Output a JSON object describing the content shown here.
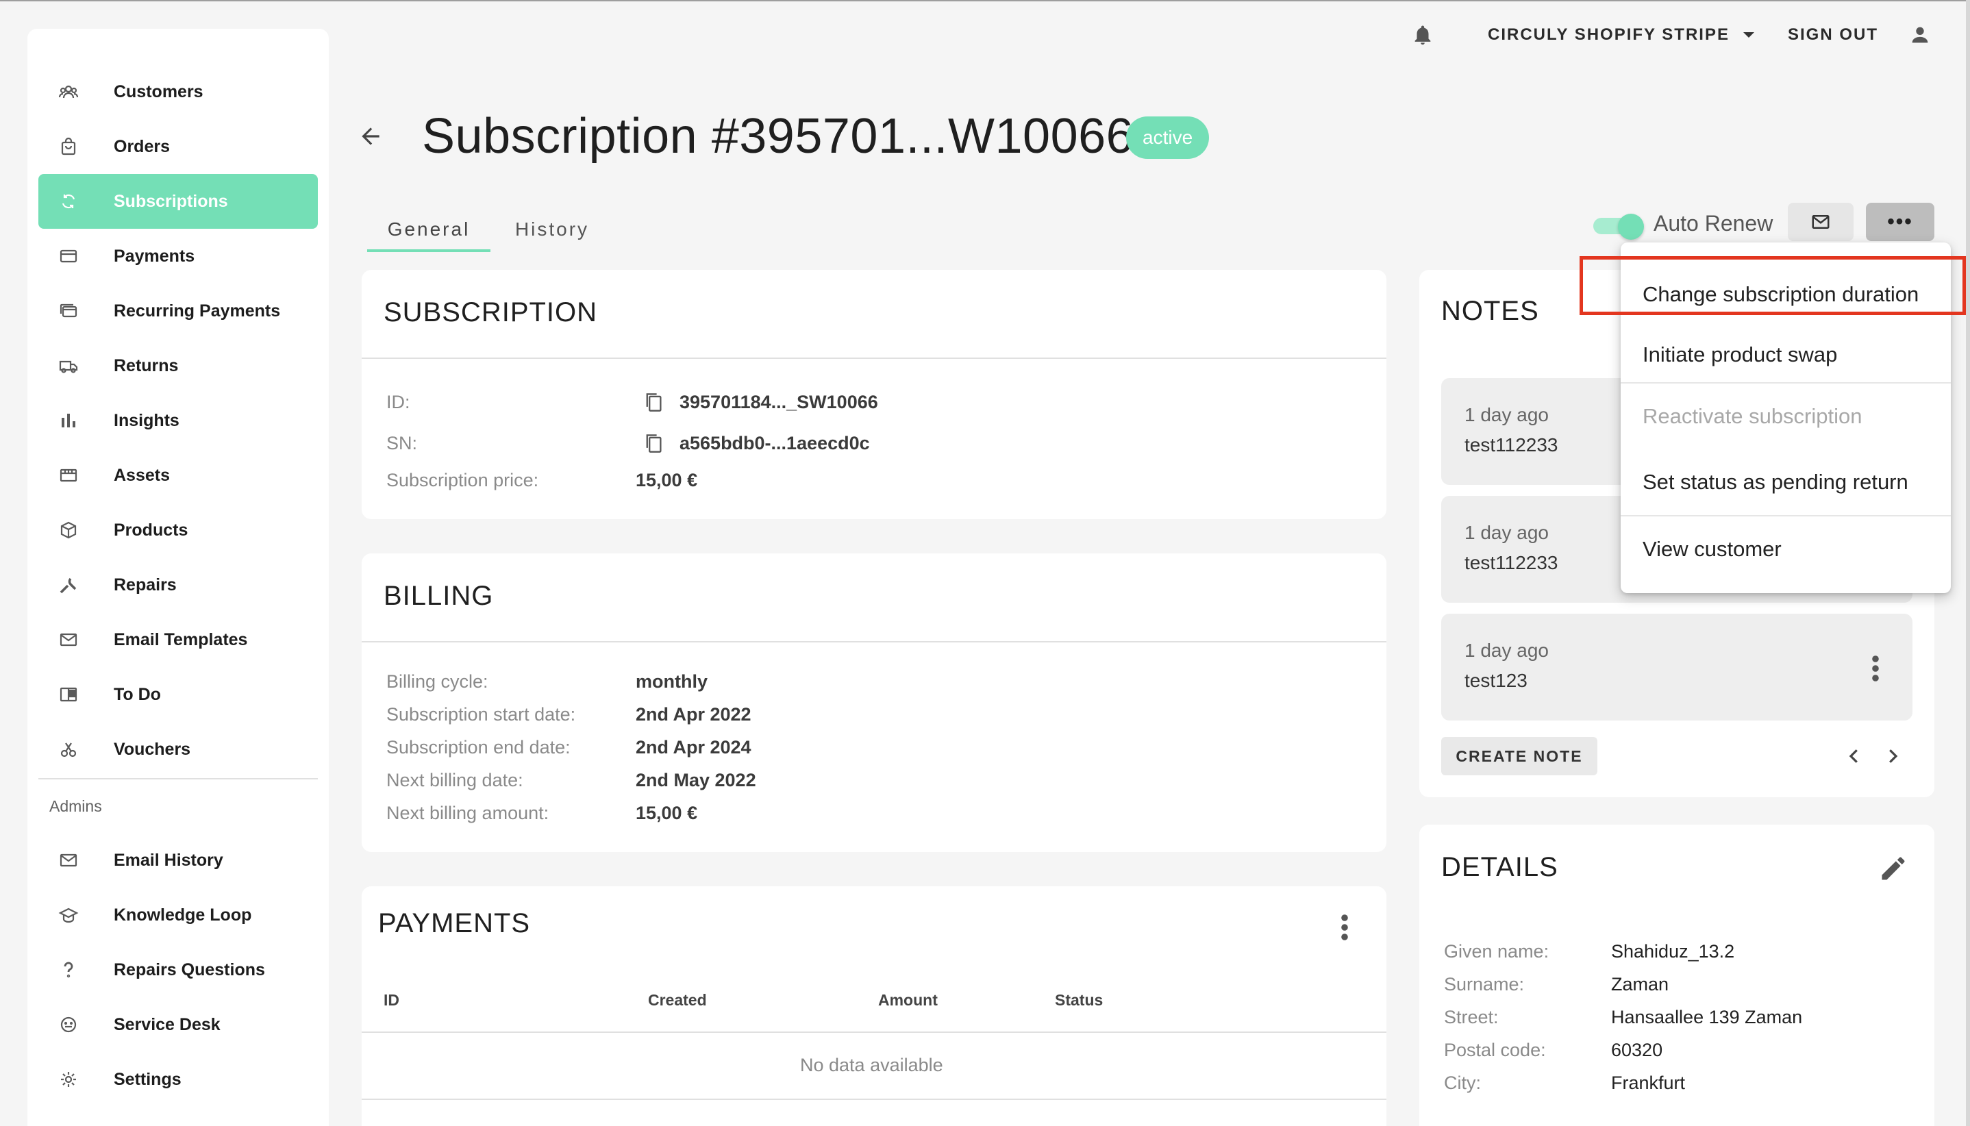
{
  "topbar": {
    "org_label": "CIRCULY SHOPIFY STRIPE",
    "sign_out_label": "SIGN OUT"
  },
  "sidebar": {
    "items": [
      {
        "label": "Customers",
        "icon": "customers-icon"
      },
      {
        "label": "Orders",
        "icon": "orders-icon"
      },
      {
        "label": "Subscriptions",
        "icon": "subscriptions-icon",
        "active": true
      },
      {
        "label": "Payments",
        "icon": "payments-icon"
      },
      {
        "label": "Recurring Payments",
        "icon": "recurring-payments-icon"
      },
      {
        "label": "Returns",
        "icon": "returns-icon"
      },
      {
        "label": "Insights",
        "icon": "insights-icon"
      },
      {
        "label": "Assets",
        "icon": "assets-icon"
      },
      {
        "label": "Products",
        "icon": "products-icon"
      },
      {
        "label": "Repairs",
        "icon": "repairs-icon"
      },
      {
        "label": "Email Templates",
        "icon": "email-templates-icon"
      },
      {
        "label": "To Do",
        "icon": "to-do-icon"
      },
      {
        "label": "Vouchers",
        "icon": "vouchers-icon"
      }
    ],
    "admins_heading": "Admins",
    "admin_items": [
      {
        "label": "Email History",
        "icon": "email-history-icon"
      },
      {
        "label": "Knowledge Loop",
        "icon": "knowledge-loop-icon"
      },
      {
        "label": "Repairs Questions",
        "icon": "repairs-questions-icon"
      },
      {
        "label": "Service Desk",
        "icon": "service-desk-icon"
      },
      {
        "label": "Settings",
        "icon": "settings-icon"
      }
    ]
  },
  "header": {
    "title": "Subscription #395701...W10066",
    "status_badge": "active"
  },
  "tabs": [
    {
      "label": "General",
      "active": true
    },
    {
      "label": "History"
    }
  ],
  "actions": {
    "auto_renew_label": "Auto Renew",
    "auto_renew_on": true,
    "more_label": "•••"
  },
  "subscription": {
    "title": "SUBSCRIPTION",
    "id_label": "ID:",
    "id_value": "395701184..._SW10066",
    "sn_label": "SN:",
    "sn_value": "a565bdb0-...1aeecd0c",
    "price_label": "Subscription price:",
    "price_value": "15,00 €"
  },
  "billing": {
    "title": "BILLING",
    "rows": [
      {
        "label": "Billing cycle:",
        "value": "monthly"
      },
      {
        "label": "Subscription start date:",
        "value": "2nd Apr 2022"
      },
      {
        "label": "Subscription end date:",
        "value": "2nd Apr 2024"
      },
      {
        "label": "Next billing date:",
        "value": "2nd May 2022"
      },
      {
        "label": "Next billing amount:",
        "value": "15,00 €"
      }
    ]
  },
  "payments": {
    "title": "PAYMENTS",
    "columns": [
      "ID",
      "Created",
      "Amount",
      "Status"
    ],
    "empty_text": "No data available"
  },
  "notes": {
    "title": "NOTES",
    "items": [
      {
        "time": "1 day ago",
        "text": "test112233"
      },
      {
        "time": "1 day ago",
        "text": "test112233"
      },
      {
        "time": "1 day ago",
        "text": "test123"
      }
    ],
    "create_label": "CREATE NOTE"
  },
  "details": {
    "title": "DETAILS",
    "rows": [
      {
        "label": "Given name:",
        "value": "Shahiduz_13.2"
      },
      {
        "label": "Surname:",
        "value": "Zaman"
      },
      {
        "label": "Street:",
        "value": "Hansaallee 139 Zaman"
      },
      {
        "label": "Postal code:",
        "value": "60320"
      },
      {
        "label": "City:",
        "value": "Frankfurt"
      }
    ]
  },
  "menu": {
    "items": [
      {
        "label": "Change subscription duration",
        "disabled": false
      },
      {
        "label": "Initiate product swap",
        "disabled": false
      },
      {
        "label": "Reactivate subscription",
        "disabled": true
      },
      {
        "label": "Set status as pending return",
        "disabled": false
      },
      {
        "label": "View customer",
        "disabled": false
      }
    ]
  },
  "colors": {
    "accent": "#74dfb6",
    "highlight": "#e3361f"
  }
}
